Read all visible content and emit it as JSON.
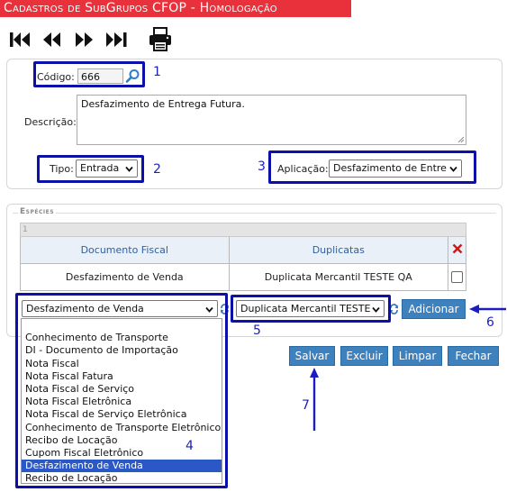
{
  "header": {
    "title": "Cadastros de SubGrupos CFOP  - Homologação"
  },
  "toolbar": {
    "first_icon": "first-page-icon",
    "prev_icon": "previous-page-icon",
    "next_icon": "next-page-icon",
    "last_icon": "last-page-icon",
    "print_icon": "printer-icon"
  },
  "form": {
    "codigo_label": "Código:",
    "codigo_value": "666",
    "descricao_label": "Descrição:",
    "descricao_value": "Desfazimento de Entrega Futura.",
    "tipo_label": "Tipo:",
    "tipo_value": "Entrada",
    "aplicacao_label": "Aplicação:",
    "aplicacao_value": "Desfazimento de Entre"
  },
  "especies": {
    "legend": "Espécies",
    "row_number": "1",
    "columns": [
      "Documento Fiscal",
      "Duplicatas"
    ],
    "rows": [
      {
        "documento": "Desfazimento de Venda",
        "duplicata": "Duplicata Mercantil TESTE QA"
      }
    ],
    "documento_select_value": "Desfazimento de Venda",
    "duplicata_select_value": "Duplicata Mercantil TESTE",
    "add_button": "Adicionar",
    "documento_options": [
      "",
      "Conhecimento de Transporte",
      "DI - Documento de Importação",
      "Nota Fiscal",
      "Nota Fiscal Fatura",
      "Nota Fiscal de Serviço",
      "Nota Fiscal Eletrônica",
      "Nota Fiscal de Serviço Eletrônica",
      "Conhecimento de Transporte Eletrônico",
      "Recibo de Locação",
      "Cupom Fiscal Eletrônico",
      "Desfazimento de Venda",
      "Recibo de Locação"
    ],
    "selected_option_index": 11
  },
  "actions": {
    "save": "Salvar",
    "delete": "Excluir",
    "clear": "Limpar",
    "close": "Fechar"
  },
  "annotations": {
    "n1": "1",
    "n2": "2",
    "n3": "3",
    "n4": "4",
    "n5": "5",
    "n6": "6",
    "n7": "7",
    "color": "#0b10a8"
  },
  "colors": {
    "title_bg": "#e8313a",
    "button_bg": "#3d82bf",
    "delete_x": "#cc1a1a",
    "selected_option": "#2a58c6"
  }
}
